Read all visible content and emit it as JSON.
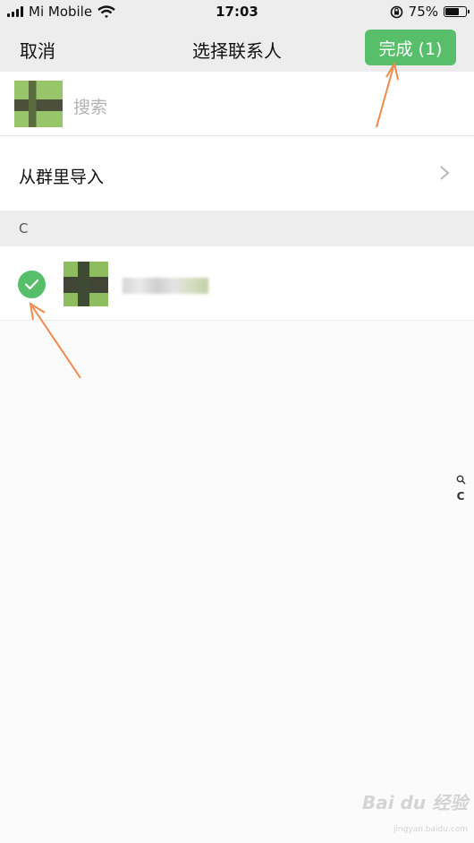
{
  "status_bar": {
    "carrier": "Mi Mobile",
    "time": "17:03",
    "battery_percent": "75%",
    "battery_level": 0.75
  },
  "nav": {
    "cancel_label": "取消",
    "title": "选择联系人",
    "done_label": "完成 (1)"
  },
  "search": {
    "placeholder": "搜索"
  },
  "import_from_group": {
    "label": "从群里导入"
  },
  "contacts": {
    "section_letter": "C",
    "items": [
      {
        "selected": true,
        "name_visible": false
      }
    ]
  },
  "index_bar": {
    "search_icon": "search-icon",
    "letters": [
      "C"
    ]
  },
  "colors": {
    "accent": "#57be6a",
    "nav_background": "#ededed",
    "annotation_arrow": "#f08a4b"
  },
  "watermark": {
    "brand": "Bai du 经验",
    "url": "jingyan.baidu.com"
  }
}
